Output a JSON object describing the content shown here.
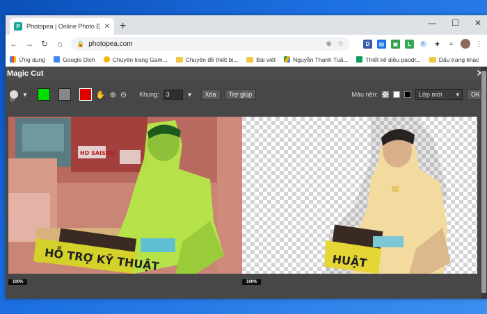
{
  "browser": {
    "tab_title": "Photopea | Online Photo Editor",
    "tab_favicon_letter": "P",
    "new_tab_symbol": "+",
    "window_controls": {
      "minimize": "—",
      "maximize": "☐",
      "close": "✕"
    },
    "url": "photopea.com",
    "colors": {
      "tab_strip": "#dee1e6",
      "favicon": "#18a497"
    }
  },
  "bookmarks": [
    {
      "label": "Ứng dụng",
      "icon": "apps-grid-icon"
    },
    {
      "label": "Google Dịch",
      "icon": "google-translate-icon"
    },
    {
      "label": "Chuyên trang Gam...",
      "icon": "runner-icon"
    },
    {
      "label": "Chuyên đề thiết bị...",
      "icon": "folder-icon"
    },
    {
      "label": "Bài viết",
      "icon": "folder-icon"
    },
    {
      "label": "Nguyễn Thanh Tuấ...",
      "icon": "drive-icon"
    },
    {
      "label": "Thiết kế diều paodr...",
      "icon": "sheets-icon"
    },
    {
      "label": "Dấu trang khác",
      "icon": "folder-icon"
    }
  ],
  "dialog": {
    "title": "Magic Cut",
    "close_symbol": "✕"
  },
  "toolbar": {
    "brush_size": "53",
    "swatches": {
      "foreground": "#00e000",
      "neutral": "#888888",
      "background": "#e00000"
    },
    "frame_label": "Khung:",
    "frame_value": "3",
    "clear_label": "Xóa",
    "help_label": "Trợ giúp",
    "bg_color_label": "Màu nền:",
    "layer_select": "Lớp mới",
    "ok_label": "OK"
  },
  "canvas": {
    "left_zoom": "100%",
    "right_zoom": "100%",
    "sign_text": "HỖ TRỢ KỸ THUẬT",
    "sign_text_right": "HUẬT",
    "brand_text": "HD SAISON"
  }
}
